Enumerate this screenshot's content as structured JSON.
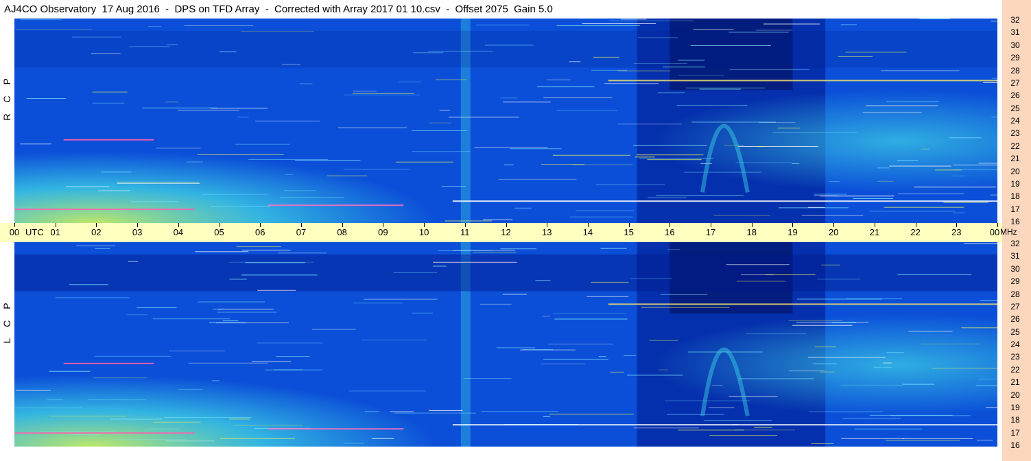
{
  "title": "AJ4CO Observatory  17 Aug 2016  -  DPS on TFD Array  -  Corrected with Array 2017 01 10.csv  -  Offset 2075  Gain 5.0",
  "chart_data": [
    {
      "type": "heatmap",
      "name": "RCP",
      "label_letters": [
        "R",
        "C",
        "P"
      ],
      "x_ticks": [
        "00",
        "01",
        "02",
        "03",
        "04",
        "05",
        "06",
        "07",
        "08",
        "09",
        "10",
        "11",
        "12",
        "13",
        "14",
        "15",
        "16",
        "17",
        "18",
        "19",
        "20",
        "21",
        "22",
        "23",
        "00"
      ],
      "x_unit": "UTC",
      "y_ticks": [
        16,
        17,
        18,
        19,
        20,
        21,
        22,
        23,
        24,
        25,
        26,
        27,
        28,
        29,
        30,
        31,
        32
      ],
      "y_unit": "MHz",
      "xlim": [
        0,
        24
      ],
      "ylim": [
        16,
        32
      ]
    },
    {
      "type": "heatmap",
      "name": "LCP",
      "label_letters": [
        "L",
        "C",
        "P"
      ],
      "x_ticks": [
        "00",
        "01",
        "02",
        "03",
        "04",
        "05",
        "06",
        "07",
        "08",
        "09",
        "10",
        "11",
        "12",
        "13",
        "14",
        "15",
        "16",
        "17",
        "18",
        "19",
        "20",
        "21",
        "22",
        "23",
        "00"
      ],
      "x_unit": "UTC",
      "y_ticks": [
        16,
        17,
        18,
        19,
        20,
        21,
        22,
        23,
        24,
        25,
        26,
        27,
        28,
        29,
        30,
        31,
        32
      ],
      "y_unit": "MHz",
      "xlim": [
        0,
        24
      ],
      "ylim": [
        16,
        32
      ]
    }
  ],
  "colors": {
    "background_blue": "#0b4fd8",
    "dark_blue": "#02188a",
    "cyan": "#3fd6e6",
    "yellow_green": "#c8f060",
    "axis_band": "#ffffc0",
    "side_strip": "#fbd7bd"
  }
}
